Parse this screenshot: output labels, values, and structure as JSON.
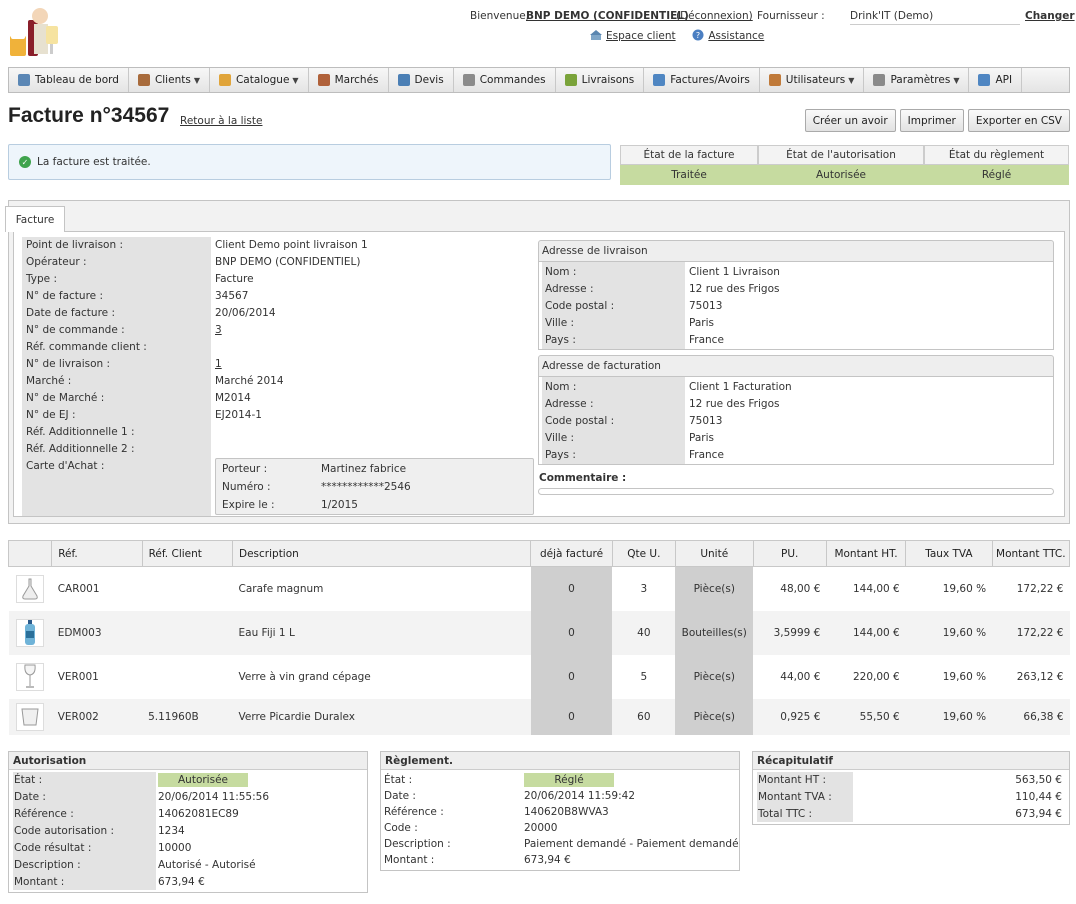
{
  "header": {
    "welcome": "Bienvenue,",
    "user": "BNP DEMO (CONFIDENTIEL)",
    "logout": "(Déconnexion)",
    "supplier_label": "Fournisseur :",
    "supplier_value": "Drink'IT (Demo)",
    "change": "Changer",
    "espace_client": "Espace client",
    "assistance": "Assistance"
  },
  "nav": [
    {
      "label": "Tableau de bord",
      "icon": "dashboard-icon",
      "caret": false
    },
    {
      "label": "Clients",
      "icon": "clients-icon",
      "caret": true
    },
    {
      "label": "Catalogue",
      "icon": "catalogue-icon",
      "caret": true
    },
    {
      "label": "Marchés",
      "icon": "markets-icon",
      "caret": false
    },
    {
      "label": "Devis",
      "icon": "quote-icon",
      "caret": false
    },
    {
      "label": "Commandes",
      "icon": "orders-icon",
      "caret": false
    },
    {
      "label": "Livraisons",
      "icon": "delivery-icon",
      "caret": false
    },
    {
      "label": "Factures/Avoirs",
      "icon": "invoice-icon",
      "caret": false
    },
    {
      "label": "Utilisateurs",
      "icon": "users-icon",
      "caret": true
    },
    {
      "label": "Paramètres",
      "icon": "settings-icon",
      "caret": true
    },
    {
      "label": "API",
      "icon": "api-icon",
      "caret": false
    }
  ],
  "page": {
    "title": "Facture n°34567",
    "back": "Retour à la liste",
    "buttons": {
      "credit": "Créer un avoir",
      "print": "Imprimer",
      "export": "Exporter en CSV"
    },
    "alert": "La facture est traitée."
  },
  "states": {
    "headers": [
      "État de la facture",
      "État de l'autorisation",
      "État du règlement"
    ],
    "values": [
      "Traitée",
      "Autorisée",
      "Réglé"
    ]
  },
  "tab": "Facture",
  "details": [
    {
      "label": "Point de livraison :",
      "value": "Client Demo point livraison 1",
      "link": false
    },
    {
      "label": "Opérateur :",
      "value": "BNP DEMO (CONFIDENTIEL)",
      "link": false
    },
    {
      "label": "Type :",
      "value": "Facture",
      "link": false
    },
    {
      "label": "N° de facture :",
      "value": "34567",
      "link": false
    },
    {
      "label": "Date de facture :",
      "value": "20/06/2014",
      "link": false
    },
    {
      "label": "N° de commande :",
      "value": "3",
      "link": true
    },
    {
      "label": "Réf. commande client :",
      "value": "",
      "link": false
    },
    {
      "label": "N° de livraison :",
      "value": "1",
      "link": true
    },
    {
      "label": "Marché :",
      "value": "Marché 2014",
      "link": false
    },
    {
      "label": "N° de Marché :",
      "value": "M2014",
      "link": false
    },
    {
      "label": "N° de EJ :",
      "value": "EJ2014-1",
      "link": false
    },
    {
      "label": "Réf. Additionnelle 1 :",
      "value": "",
      "link": false
    },
    {
      "label": "Réf. Additionnelle 2 :",
      "value": "",
      "link": false
    },
    {
      "label": "Carte d'Achat :",
      "value": "",
      "link": false
    }
  ],
  "card": [
    {
      "label": "Porteur :",
      "value": "Martinez fabrice"
    },
    {
      "label": "Numéro :",
      "value": "************2546"
    },
    {
      "label": "Expire le :",
      "value": "1/2015"
    }
  ],
  "delivery": {
    "title": "Adresse de livraison",
    "rows": [
      {
        "label": "Nom :",
        "value": "Client 1 Livraison"
      },
      {
        "label": "Adresse :",
        "value": "12 rue des Frigos"
      },
      {
        "label": "Code postal :",
        "value": "75013"
      },
      {
        "label": "Ville :",
        "value": "Paris"
      },
      {
        "label": "Pays :",
        "value": "France"
      }
    ]
  },
  "billing": {
    "title": "Adresse de facturation",
    "rows": [
      {
        "label": "Nom :",
        "value": "Client 1 Facturation"
      },
      {
        "label": "Adresse :",
        "value": "12 rue des Frigos"
      },
      {
        "label": "Code postal :",
        "value": "75013"
      },
      {
        "label": "Ville :",
        "value": "Paris"
      },
      {
        "label": "Pays :",
        "value": "France"
      }
    ]
  },
  "comment_label": "Commentaire :",
  "table": {
    "headers": [
      "",
      "Réf.",
      "Réf. Client",
      "Description",
      "déjà facturé",
      "Qte U.",
      "Unité",
      "PU.",
      "Montant HT.",
      "Taux TVA",
      "Montant TTC."
    ],
    "rows": [
      {
        "icon": "carafe-icon",
        "ref": "CAR001",
        "ref_client": "",
        "desc": "Carafe magnum",
        "billed": "0",
        "qty": "3",
        "unit": "Pièce(s)",
        "pu": "48,00 €",
        "ht": "144,00 €",
        "tva": "19,60 %",
        "ttc": "172,22 €"
      },
      {
        "icon": "water-bottle-icon",
        "ref": "EDM003",
        "ref_client": "",
        "desc": "Eau Fiji 1 L",
        "billed": "0",
        "qty": "40",
        "unit": "Bouteilles(s)",
        "pu": "3,5999 €",
        "ht": "144,00 €",
        "tva": "19,60 %",
        "ttc": "172,22 €"
      },
      {
        "icon": "wine-glass-icon",
        "ref": "VER001",
        "ref_client": "",
        "desc": "Verre à vin grand cépage",
        "billed": "0",
        "qty": "5",
        "unit": "Pièce(s)",
        "pu": "44,00 €",
        "ht": "220,00 €",
        "tva": "19,60 %",
        "ttc": "263,12 €"
      },
      {
        "icon": "tumbler-icon",
        "ref": "VER002",
        "ref_client": "5.11960B",
        "desc": "Verre Picardie Duralex",
        "billed": "0",
        "qty": "60",
        "unit": "Pièce(s)",
        "pu": "0,925 €",
        "ht": "55,50 €",
        "tva": "19,60 %",
        "ttc": "66,38 €"
      }
    ]
  },
  "authorization": {
    "title": "Autorisation",
    "state_label": "État :",
    "state": "Autorisée",
    "rows": [
      {
        "label": "Date :",
        "value": "20/06/2014 11:55:56"
      },
      {
        "label": "Référence :",
        "value": "14062081EC89"
      },
      {
        "label": "Code autorisation :",
        "value": "1234"
      },
      {
        "label": "Code résultat :",
        "value": "10000"
      },
      {
        "label": "Description :",
        "value": "Autorisé - Autorisé"
      },
      {
        "label": "Montant :",
        "value": "673,94 €"
      }
    ]
  },
  "payment": {
    "title": "Règlement.",
    "state_label": "État :",
    "state": "Réglé",
    "rows": [
      {
        "label": "Date :",
        "value": "20/06/2014 11:59:42"
      },
      {
        "label": "Référence :",
        "value": "140620B8WVA3"
      },
      {
        "label": "Code :",
        "value": "20000"
      },
      {
        "label": "Description :",
        "value": "Paiement demandé - Paiement demandé"
      },
      {
        "label": "Montant :",
        "value": "673,94 €"
      }
    ]
  },
  "summary": {
    "title": "Récapitulatif",
    "rows": [
      {
        "label": "Montant HT :",
        "value": "563,50 €"
      },
      {
        "label": "Montant TVA :",
        "value": "110,44 €"
      },
      {
        "label": "Total TTC :",
        "value": "673,94 €"
      }
    ]
  },
  "colors": {
    "accent_green": "#c6dba0",
    "ok_green": "#3fa34d",
    "alert_bg": "#eef5fb"
  }
}
